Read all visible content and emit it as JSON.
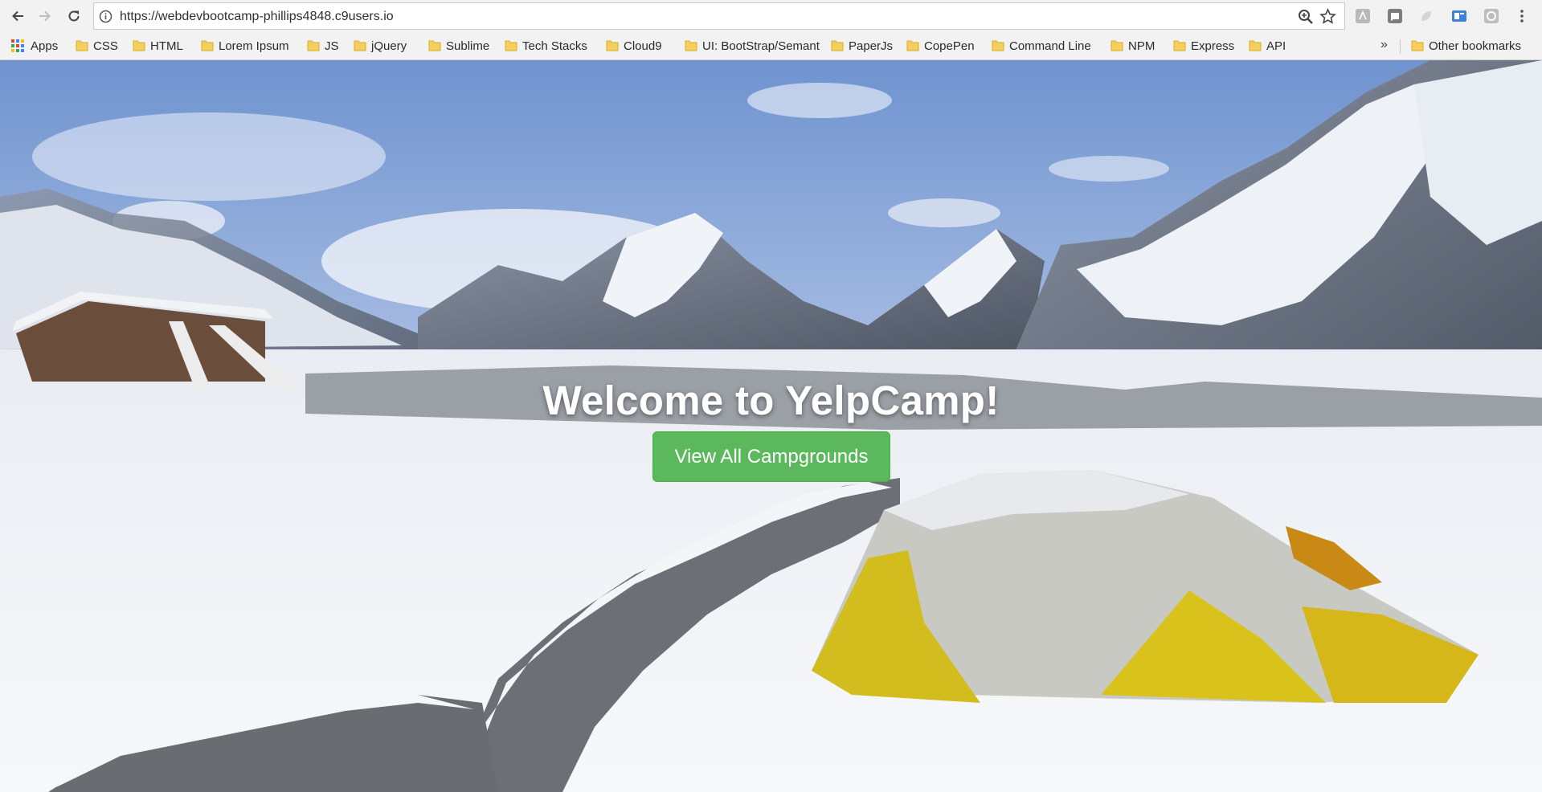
{
  "browser": {
    "url": "https://webdevbootcamp-phillips4848.c9users.io",
    "nav": {
      "back_icon": "back-arrow-icon",
      "forward_icon": "forward-arrow-icon",
      "reload_icon": "reload-icon"
    },
    "extensions": [
      "extension-icon-a",
      "extension-icon-b",
      "extension-icon-c",
      "extension-icon-d",
      "extension-icon-e"
    ]
  },
  "bookmarks": {
    "apps_label": "Apps",
    "items": [
      {
        "label": "CSS"
      },
      {
        "label": "HTML"
      },
      {
        "label": "Lorem Ipsum"
      },
      {
        "label": "JS"
      },
      {
        "label": "jQuery"
      },
      {
        "label": "Sublime"
      },
      {
        "label": "Tech Stacks"
      },
      {
        "label": "Cloud9"
      },
      {
        "label": "UI: BootStrap/Semant"
      },
      {
        "label": "PaperJs"
      },
      {
        "label": "CopePen"
      },
      {
        "label": "Command Line"
      },
      {
        "label": "NPM"
      },
      {
        "label": "Express"
      },
      {
        "label": "API"
      }
    ],
    "overflow": "»",
    "other_label": "Other bookmarks"
  },
  "hero": {
    "title": "Welcome to YelpCamp!",
    "button_label": "View All Campgrounds",
    "button_color": "#5cb85c"
  }
}
